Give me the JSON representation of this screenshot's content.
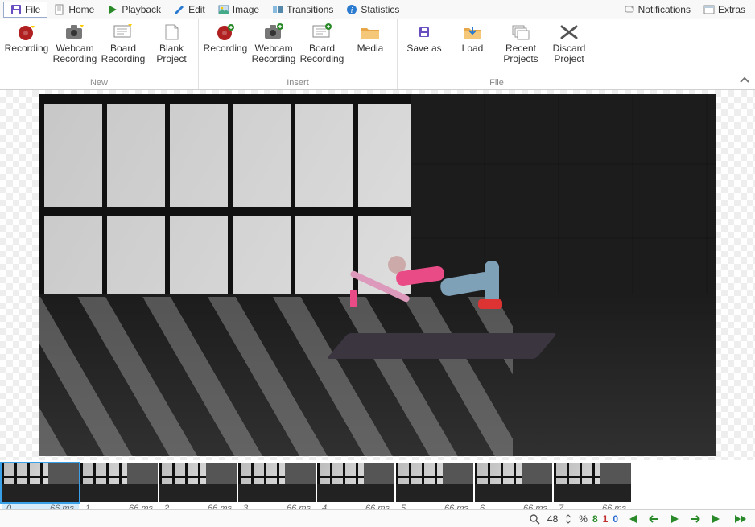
{
  "menubar": {
    "tabs": [
      {
        "label": "File",
        "icon": "save-icon",
        "active": true
      },
      {
        "label": "Home",
        "icon": "doc-icon"
      },
      {
        "label": "Playback",
        "icon": "play-icon"
      },
      {
        "label": "Edit",
        "icon": "pencil-icon"
      },
      {
        "label": "Image",
        "icon": "image-icon"
      },
      {
        "label": "Transitions",
        "icon": "transitions-icon"
      },
      {
        "label": "Statistics",
        "icon": "info-icon"
      }
    ],
    "right": [
      {
        "label": "Notifications",
        "icon": "bell-icon"
      },
      {
        "label": "Extras",
        "icon": "window-icon"
      }
    ]
  },
  "ribbon": {
    "groups": [
      {
        "label": "New",
        "items": [
          {
            "label": "Recording",
            "icon": "record-icon"
          },
          {
            "label": "Webcam Recording",
            "icon": "webcam-icon"
          },
          {
            "label": "Board Recording",
            "icon": "board-icon"
          },
          {
            "label": "Blank Project",
            "icon": "blank-icon"
          }
        ]
      },
      {
        "label": "Insert",
        "items": [
          {
            "label": "Recording",
            "icon": "record-add-icon"
          },
          {
            "label": "Webcam Recording",
            "icon": "webcam-add-icon"
          },
          {
            "label": "Board Recording",
            "icon": "board-add-icon"
          },
          {
            "label": "Media",
            "icon": "folder-icon"
          }
        ]
      },
      {
        "label": "File",
        "items": [
          {
            "label": "Save as",
            "icon": "save-as-icon"
          },
          {
            "label": "Load",
            "icon": "load-icon"
          },
          {
            "label": "Recent Projects",
            "icon": "recent-icon"
          },
          {
            "label": "Discard Project",
            "icon": "discard-icon"
          }
        ]
      }
    ]
  },
  "thumbnails": [
    {
      "index": "0",
      "duration": "66 ms",
      "active": true
    },
    {
      "index": "1",
      "duration": "66 ms"
    },
    {
      "index": "2",
      "duration": "66 ms"
    },
    {
      "index": "3",
      "duration": "66 ms"
    },
    {
      "index": "4",
      "duration": "66 ms"
    },
    {
      "index": "5",
      "duration": "66 ms"
    },
    {
      "index": "6",
      "duration": "66 ms"
    },
    {
      "index": "7",
      "duration": "66 ms"
    }
  ],
  "statusbar": {
    "zoom": "48",
    "zoom_unit": "%",
    "num_a": "8",
    "num_b": "1",
    "num_c": "0"
  }
}
